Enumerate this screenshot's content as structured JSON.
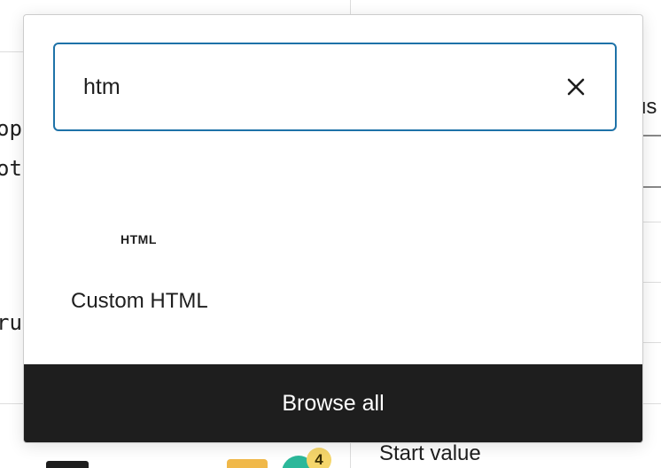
{
  "background": {
    "left_code_lines": [
      "op:",
      "ott",
      "rue"
    ],
    "right_text_top": "us",
    "right_text_bottom": "Start value",
    "notification_count": "4",
    "icons": [
      "folder-icon",
      "avatar-icon"
    ]
  },
  "inserter": {
    "search": {
      "value": "htm",
      "clear_icon": "close-icon"
    },
    "results": [
      {
        "icon_text": "HTML",
        "label": "Custom HTML"
      }
    ],
    "browse_all_label": "Browse all"
  },
  "colors": {
    "focus_border": "#1e72a8",
    "dark_bar": "#1e1e1e",
    "badge": "#f5d66b",
    "avatar": "#2cb89a",
    "folder": "#f0b849"
  }
}
